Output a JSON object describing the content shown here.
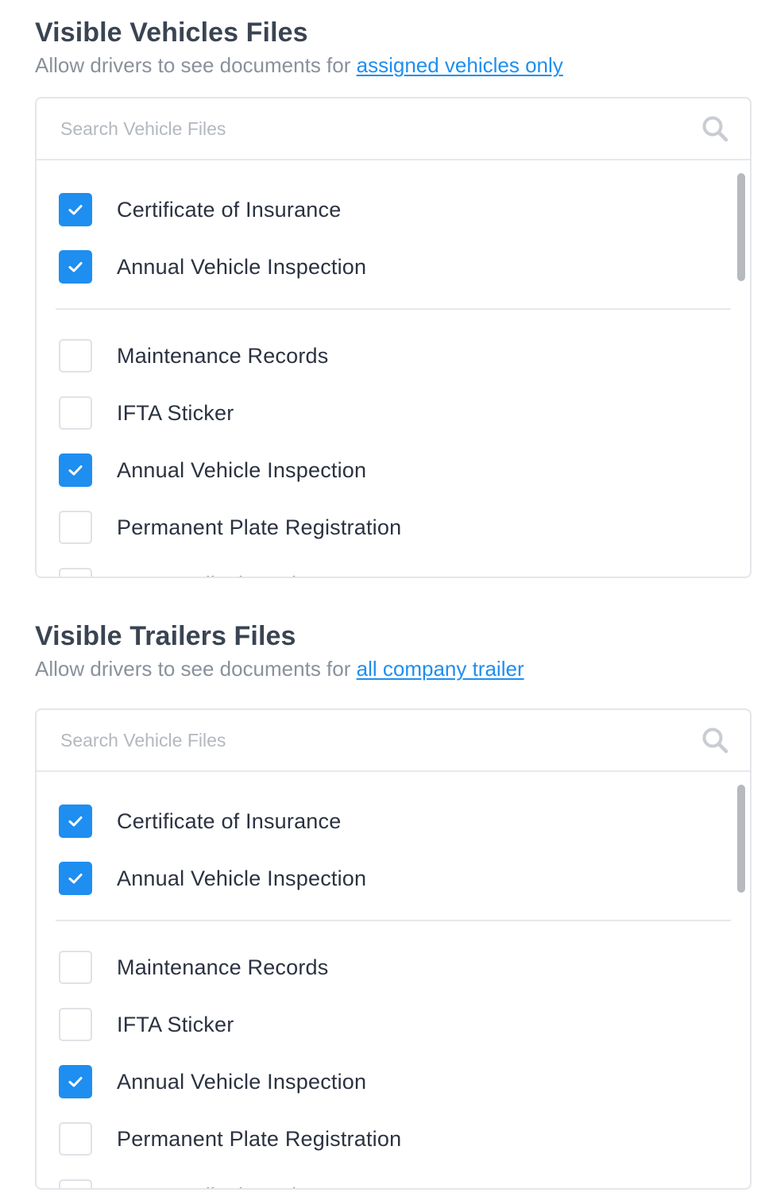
{
  "vehicles": {
    "title": "Visible Vehicles Files",
    "subtitle_prefix": "Allow drivers to see documents for ",
    "subtitle_link": "assigned vehicles only",
    "search_placeholder": "Search Vehicle Files",
    "pinned": [
      {
        "label": "Certificate of Insurance",
        "checked": true
      },
      {
        "label": "Annual Vehicle Inspection",
        "checked": true
      }
    ],
    "items": [
      {
        "label": "Maintenance Records",
        "checked": false
      },
      {
        "label": "IFTA Sticker",
        "checked": false
      },
      {
        "label": "Annual Vehicle Inspection",
        "checked": true
      },
      {
        "label": "Permanent Plate Registration",
        "checked": false
      },
      {
        "label": "DOT Medical Card",
        "checked": false
      }
    ]
  },
  "trailers": {
    "title": "Visible Trailers Files",
    "subtitle_prefix": "Allow drivers to see documents for ",
    "subtitle_link": "all company trailer",
    "search_placeholder": "Search Vehicle Files",
    "pinned": [
      {
        "label": "Certificate of Insurance",
        "checked": true
      },
      {
        "label": "Annual Vehicle Inspection",
        "checked": true
      }
    ],
    "items": [
      {
        "label": "Maintenance Records",
        "checked": false
      },
      {
        "label": "IFTA Sticker",
        "checked": false
      },
      {
        "label": "Annual Vehicle Inspection",
        "checked": true
      },
      {
        "label": "Permanent Plate Registration",
        "checked": false
      },
      {
        "label": "DOT Medical Card",
        "checked": false
      }
    ]
  },
  "colors": {
    "accent": "#1e8ef0",
    "checkbox_border": "#dfe2e6",
    "title": "#3a4452",
    "subtitle": "#8a919b"
  },
  "icons": {
    "search": "search-icon",
    "check": "check-icon"
  }
}
